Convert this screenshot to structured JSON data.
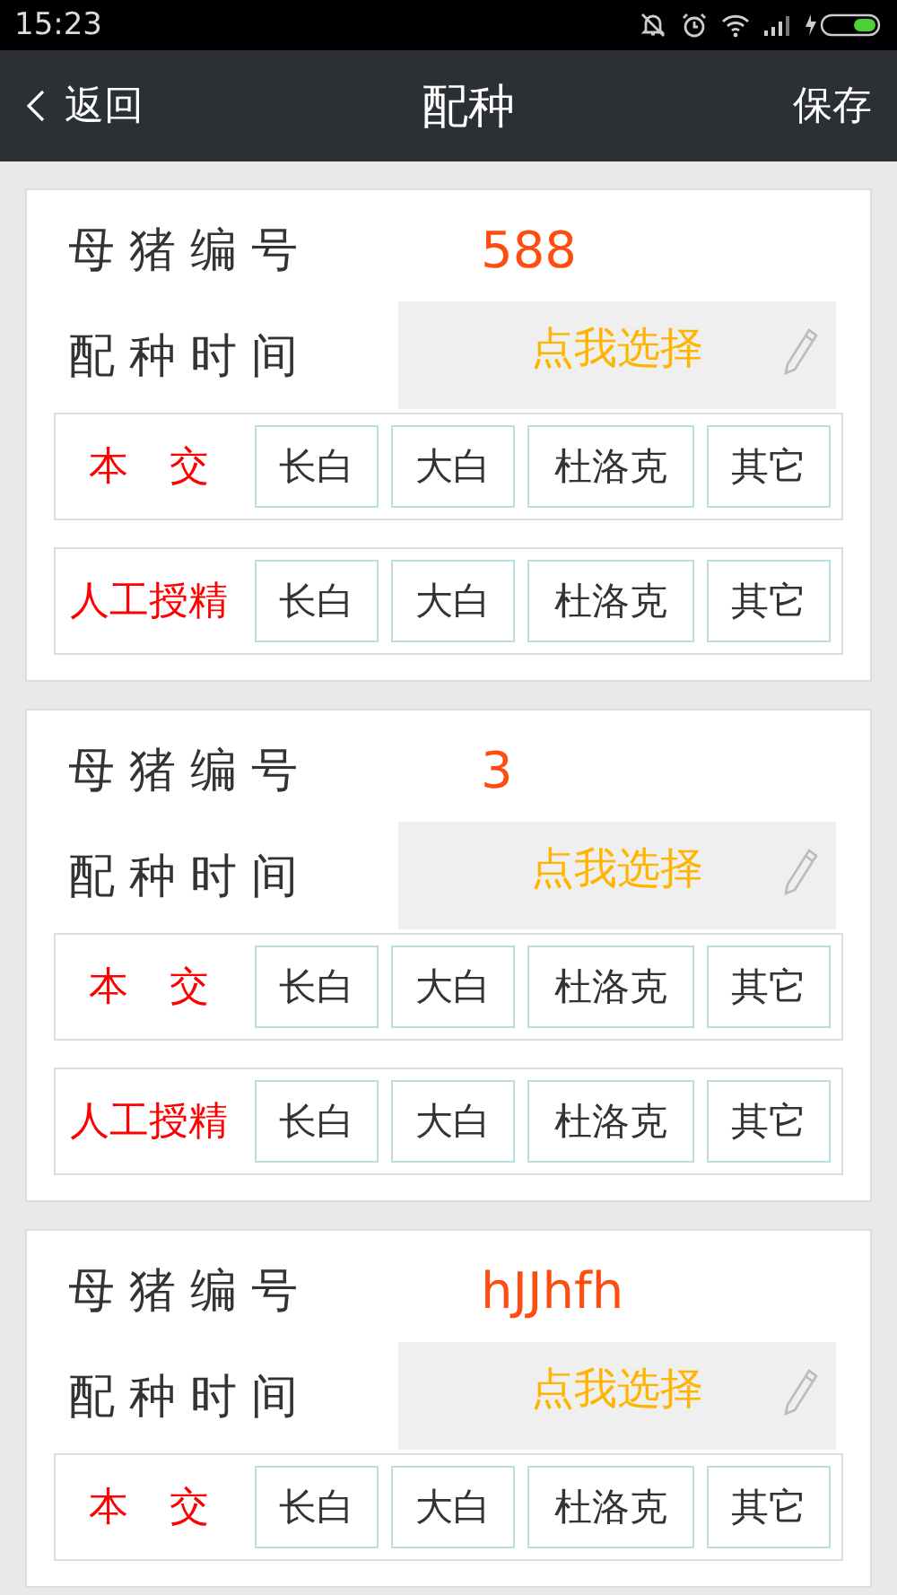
{
  "status_bar": {
    "time": "15:23"
  },
  "header": {
    "back": "返回",
    "title": "配种",
    "action": "保存"
  },
  "cards": [
    {
      "sow_label": "母猪编号",
      "sow_id": "588",
      "time_label": "配种时间",
      "time_button": "点我选择",
      "groups": [
        {
          "label": "本 交",
          "options": [
            "长白",
            "大白",
            "杜洛克",
            "其它"
          ]
        },
        {
          "label": "人工授精",
          "options": [
            "长白",
            "大白",
            "杜洛克",
            "其它"
          ]
        }
      ]
    },
    {
      "sow_label": "母猪编号",
      "sow_id": "3",
      "time_label": "配种时间",
      "time_button": "点我选择",
      "groups": [
        {
          "label": "本 交",
          "options": [
            "长白",
            "大白",
            "杜洛克",
            "其它"
          ]
        },
        {
          "label": "人工授精",
          "options": [
            "长白",
            "大白",
            "杜洛克",
            "其它"
          ]
        }
      ]
    },
    {
      "sow_label": "母猪编号",
      "sow_id": "hJJhfh",
      "time_label": "配种时间",
      "time_button": "点我选择",
      "groups": [
        {
          "label": "本 交",
          "options": [
            "长白",
            "大白",
            "杜洛克",
            "其它"
          ]
        }
      ]
    }
  ]
}
